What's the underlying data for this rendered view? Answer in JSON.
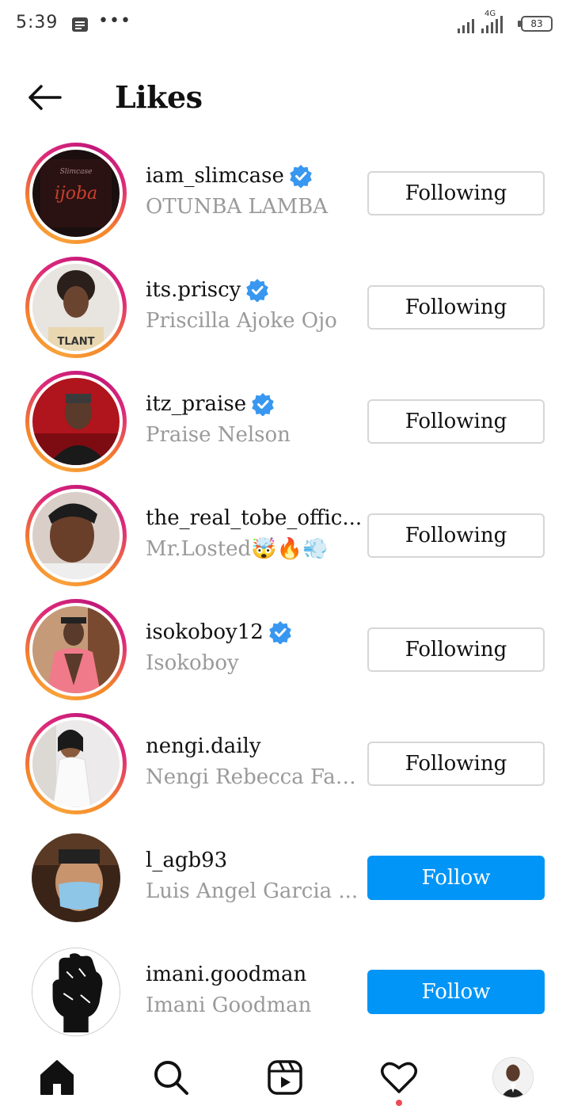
{
  "status_bar": {
    "time": "5:39",
    "dots": "•••",
    "network": "4G",
    "battery": "83"
  },
  "header": {
    "title": "Likes",
    "back_icon": "arrow-left-icon"
  },
  "likes": [
    {
      "username": "iam_slimcase",
      "fullname": "OTUNBA LAMBA",
      "verified": true,
      "button": "Following",
      "story_ring": true
    },
    {
      "username": "its.priscy",
      "fullname": "Priscilla Ajoke Ojo",
      "verified": true,
      "button": "Following",
      "story_ring": true
    },
    {
      "username": "itz_praise",
      "fullname": "Praise Nelson",
      "verified": true,
      "button": "Following",
      "story_ring": true
    },
    {
      "username": "the_real_tobe_offic...",
      "fullname": "Mr.Losted🤯🔥💨",
      "verified": false,
      "button": "Following",
      "story_ring": true
    },
    {
      "username": "isokoboy12",
      "fullname": "Isokoboy",
      "verified": true,
      "button": "Following",
      "story_ring": true
    },
    {
      "username": "nengi.daily",
      "fullname": "Nengi Rebecca Fan...",
      "verified": false,
      "button": "Following",
      "story_ring": true
    },
    {
      "username": "l_agb93",
      "fullname": "Luis Angel Garcia ...",
      "verified": false,
      "button": "Follow",
      "story_ring": false
    },
    {
      "username": "imani.goodman",
      "fullname": "Imani Goodman",
      "verified": false,
      "button": "Follow",
      "story_ring": false
    }
  ],
  "bottom_nav": {
    "items": [
      "home-icon",
      "search-icon",
      "reels-icon",
      "heart-icon",
      "profile-avatar"
    ],
    "activity_dot_color": "#ed4956"
  },
  "colors": {
    "follow_blue": "#0095f6",
    "verified_blue": "#3897f0",
    "secondary_text": "#9a9a9a"
  }
}
